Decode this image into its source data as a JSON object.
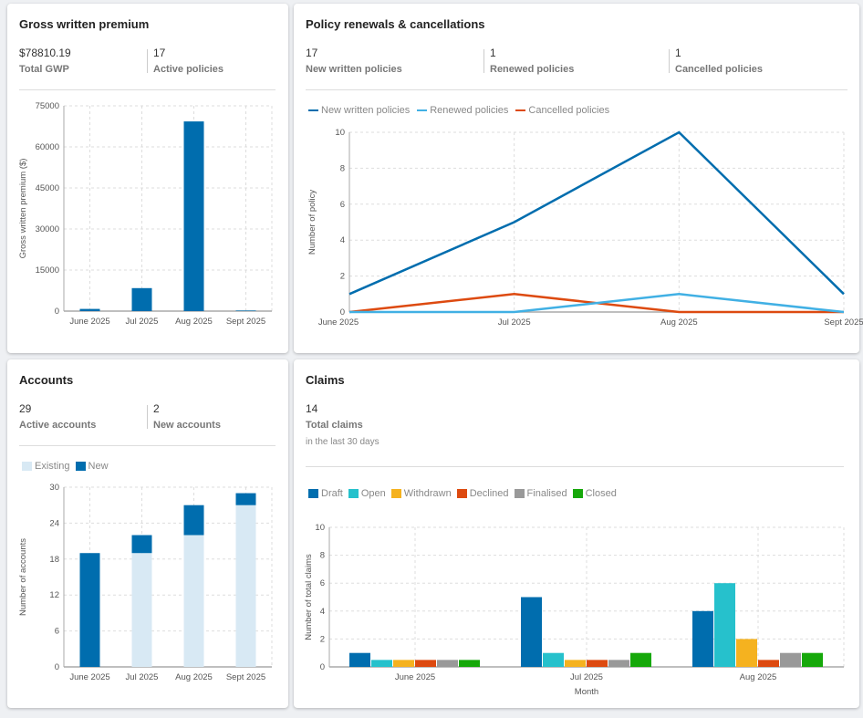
{
  "gwp": {
    "title": "Gross written premium",
    "stats": [
      {
        "value": "$78810.19",
        "label": "Total GWP"
      },
      {
        "value": "17",
        "label": "Active policies"
      }
    ]
  },
  "policy": {
    "title": "Policy renewals & cancellations",
    "stats": [
      {
        "value": "17",
        "label": "New written policies"
      },
      {
        "value": "1",
        "label": "Renewed policies"
      },
      {
        "value": "1",
        "label": "Cancelled policies"
      }
    ]
  },
  "accounts": {
    "title": "Accounts",
    "stats": [
      {
        "value": "29",
        "label": "Active accounts"
      },
      {
        "value": "2",
        "label": "New accounts"
      }
    ]
  },
  "claims": {
    "title": "Claims",
    "stats": [
      {
        "value": "14",
        "label": "Total claims"
      }
    ],
    "subtitle": "in the last 30 days"
  },
  "chart_data": [
    {
      "type": "bar",
      "ylabel": "Gross written premium ($)",
      "xlabel": "",
      "categories": [
        "June 2025",
        "Jul 2025",
        "Aug 2025",
        "Sept 2025"
      ],
      "values": [
        800,
        8400,
        69300,
        200
      ],
      "ylim": [
        0,
        75000
      ],
      "yticks": [
        0,
        15000,
        30000,
        45000,
        60000,
        75000
      ],
      "grid": true,
      "color": "#006dae"
    },
    {
      "type": "line",
      "ylabel": "Number of policy",
      "xlabel": "",
      "categories": [
        "June 2025",
        "Jul 2025",
        "Aug 2025",
        "Sept 2025"
      ],
      "ylim": [
        0,
        10
      ],
      "yticks": [
        0,
        2,
        4,
        6,
        8,
        10
      ],
      "grid": true,
      "legend": "top-left",
      "series": [
        {
          "name": "New written policies",
          "values": [
            1,
            5,
            10,
            1
          ],
          "color": "#006dae"
        },
        {
          "name": "Renewed policies",
          "values": [
            0,
            0,
            1,
            0
          ],
          "color": "#41b0e4"
        },
        {
          "name": "Cancelled policies",
          "values": [
            0,
            1,
            0,
            0
          ],
          "color": "#dd4a10"
        }
      ]
    },
    {
      "type": "bar",
      "stacked": true,
      "ylabel": "Number of accounts",
      "xlabel": "",
      "categories": [
        "June 2025",
        "Jul 2025",
        "Aug 2025",
        "Sept 2025"
      ],
      "ylim": [
        0,
        30
      ],
      "yticks": [
        0,
        6,
        12,
        18,
        24,
        30
      ],
      "grid": true,
      "legend": "top-left",
      "series": [
        {
          "name": "Existing",
          "values": [
            0,
            19,
            22,
            27
          ],
          "color": "#d8e9f4"
        },
        {
          "name": "New",
          "values": [
            19,
            3,
            5,
            2
          ],
          "color": "#006dae"
        }
      ]
    },
    {
      "type": "bar",
      "ylabel": "Number of total claims",
      "xlabel": "Month",
      "categories": [
        "June 2025",
        "Jul 2025",
        "Aug 2025"
      ],
      "ylim": [
        0,
        10
      ],
      "yticks": [
        0,
        2,
        4,
        6,
        8,
        10
      ],
      "grid": true,
      "legend": "top-left",
      "series": [
        {
          "name": "Draft",
          "values": [
            1,
            5,
            4
          ],
          "color": "#006dae"
        },
        {
          "name": "Open",
          "values": [
            0.5,
            1,
            6
          ],
          "color": "#26c1cc"
        },
        {
          "name": "Withdrawn",
          "values": [
            0.5,
            0.5,
            2
          ],
          "color": "#f5b21f"
        },
        {
          "name": "Declined",
          "values": [
            0.5,
            0.5,
            0.5
          ],
          "color": "#dd4a10"
        },
        {
          "name": "Finalised",
          "values": [
            0.5,
            0.5,
            1
          ],
          "color": "#999999"
        },
        {
          "name": "Closed",
          "values": [
            0.5,
            1,
            1
          ],
          "color": "#16a80a"
        }
      ]
    }
  ]
}
